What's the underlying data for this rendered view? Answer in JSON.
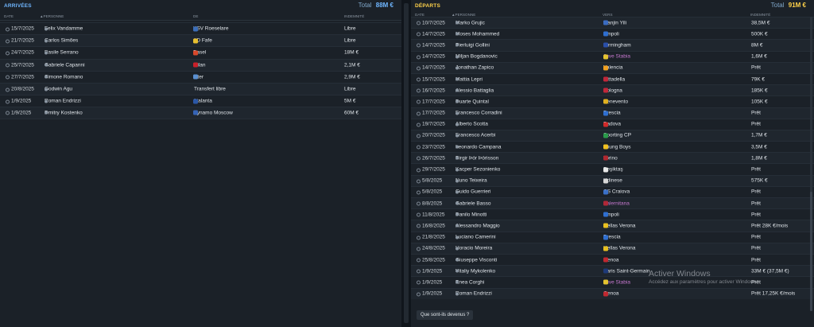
{
  "arrivals": {
    "title": "ARRIVÉES",
    "total_label": "Total",
    "total_value": "88M €",
    "columns": {
      "date": "DATE",
      "person": "PERSONNE",
      "from": "DE",
      "fee": "INDEMNITÉ"
    },
    "rows": [
      {
        "date": "15/7/2025",
        "player": "Felix Vandamme",
        "club": "KSV Roeselare",
        "fee": "Libre",
        "crest": "#3b6db8"
      },
      {
        "date": "21/7/2025",
        "player": "Carlos Simões",
        "club": "AD Fafe",
        "fee": "Libre",
        "crest": "#e8c030"
      },
      {
        "date": "24/7/2025",
        "player": "Basile Serrano",
        "club": "Basel",
        "fee": "18M €",
        "crest": "#d9482b"
      },
      {
        "date": "25/7/2025",
        "player": "Gabriele Capanni",
        "club": "Milan",
        "fee": "2,1M €",
        "crest": "#c8202a"
      },
      {
        "date": "27/7/2025",
        "player": "Simone Romano",
        "club": "Inter",
        "fee": "2,9M €",
        "crest": "#5a8fd0"
      },
      {
        "date": "20/8/2025",
        "player": "Godwin Agu",
        "club": "Transfert libre",
        "fee": "Libre",
        "crest": ""
      },
      {
        "date": "1/9/2025",
        "player": "Roman Endrizzi",
        "club": "Atalanta",
        "fee": "5M €",
        "crest": "#2b57a6"
      },
      {
        "date": "1/9/2025",
        "player": "Dmitry Kostenko",
        "club": "Dynamo Moscow",
        "fee": "60M €",
        "crest": "#3563b5"
      }
    ]
  },
  "departures": {
    "title": "DÉPARTS",
    "total_label": "Total",
    "total_value": "91M €",
    "columns": {
      "date": "DATE",
      "person": "PERSONNE",
      "to": "VERS",
      "fee": "INDEMNITÉ"
    },
    "rows": [
      {
        "date": "10/7/2025",
        "player": "Marko Grujic",
        "club": "Tianjin Yili",
        "fee": "38,5M €",
        "crest": "#3a6bc0",
        "loan": false
      },
      {
        "date": "14/7/2025",
        "player": "Moses Mohammed",
        "club": "Empoli",
        "fee": "500K €",
        "crest": "#2f6fd0",
        "loan": false
      },
      {
        "date": "14/7/2025",
        "player": "Pierluigi Gollini",
        "club": "Birmingham",
        "fee": "8M €",
        "crest": "#2a4fa8",
        "loan": false
      },
      {
        "date": "14/7/2025",
        "player": "Miljan Bogdanovic",
        "club": "Juve Stabia",
        "fee": "1,6M €",
        "crest": "#e4c330",
        "loan": true
      },
      {
        "date": "14/7/2025",
        "player": "Jonathan Zapico",
        "club": "Valencia",
        "fee": "Prêt",
        "crest": "#f0a020",
        "loan": false
      },
      {
        "date": "15/7/2025",
        "player": "Mattia Lepri",
        "club": "Cittadella",
        "fee": "79K €",
        "crest": "#c0283a",
        "loan": false
      },
      {
        "date": "16/7/2025",
        "player": "Alessio Battaglia",
        "club": "Bologna",
        "fee": "185K €",
        "crest": "#c0283a",
        "loan": false
      },
      {
        "date": "17/7/2025",
        "player": "Duarte Quintal",
        "club": "Benevento",
        "fee": "105K €",
        "crest": "#e0b020",
        "loan": false
      },
      {
        "date": "17/7/2025",
        "player": "Francesco Corradini",
        "club": "Brescia",
        "fee": "Prêt",
        "crest": "#2f6fd0",
        "loan": false
      },
      {
        "date": "19/7/2025",
        "player": "Alberto Scotta",
        "club": "Padova",
        "fee": "Prêt",
        "crest": "#d02a2a",
        "loan": false
      },
      {
        "date": "20/7/2025",
        "player": "Francesco Acerbi",
        "club": "Sporting CP",
        "fee": "1,7M €",
        "crest": "#2a9a4a",
        "loan": false
      },
      {
        "date": "23/7/2025",
        "player": "Leonardo Campana",
        "club": "Young Boys",
        "fee": "3,5M €",
        "crest": "#f0c020",
        "loan": false
      },
      {
        "date": "26/7/2025",
        "player": "Birgir Þór Þórisson",
        "club": "Torino",
        "fee": "1,8M €",
        "crest": "#b02830",
        "loan": false
      },
      {
        "date": "29/7/2025",
        "player": "Kacper Sezonienko",
        "club": "Beşiktaş",
        "fee": "Prêt",
        "crest": "#e8e8e8",
        "loan": false
      },
      {
        "date": "5/8/2025",
        "player": "Nuno Teixeira",
        "club": "Udinese",
        "fee": "575K €",
        "crest": "#d8d8d8",
        "loan": false
      },
      {
        "date": "5/8/2025",
        "player": "Guido Guerrieri",
        "club": "CS Craiova",
        "fee": "Prêt",
        "crest": "#3a70c8",
        "loan": false
      },
      {
        "date": "8/8/2025",
        "player": "Gabriele Basso",
        "club": "Salernitana",
        "fee": "Prêt",
        "crest": "#b02838",
        "loan": true
      },
      {
        "date": "11/8/2025",
        "player": "Danilo Minotti",
        "club": "Empoli",
        "fee": "Prêt",
        "crest": "#2f6fd0",
        "loan": false
      },
      {
        "date": "16/8/2025",
        "player": "Alessandro Maggio",
        "club": "Hellas Verona",
        "fee": "Prêt 28K €/mois",
        "crest": "#e8c020",
        "loan": false
      },
      {
        "date": "21/8/2025",
        "player": "Luciano Camerini",
        "club": "Brescia",
        "fee": "Prêt",
        "crest": "#2f6fd0",
        "loan": false
      },
      {
        "date": "24/8/2025",
        "player": "Horacio Moreira",
        "club": "Hellas Verona",
        "fee": "Prêt",
        "crest": "#e8c020",
        "loan": false
      },
      {
        "date": "25/8/2025",
        "player": "Giuseppe Visconti",
        "club": "Genoa",
        "fee": "Prêt",
        "crest": "#c02830",
        "loan": false
      },
      {
        "date": "1/9/2025",
        "player": "Vitaliy Mykolenko",
        "club": "Paris Saint-Germain",
        "fee": "33M € (37,5M €)",
        "crest": "#1e3a78",
        "loan": false
      },
      {
        "date": "1/9/2025",
        "player": "Enea Corghi",
        "club": "Juve Stabia",
        "fee": "Prêt",
        "crest": "#e4c330",
        "loan": true
      },
      {
        "date": "1/9/2025",
        "player": "Roman Endrizzi",
        "club": "Genoa",
        "fee": "Prêt 17,25K €/mois",
        "crest": "#c02830",
        "loan": false
      }
    ],
    "button": "Que sont-ils devenus ?"
  },
  "watermark": {
    "line1": "Activer Windows",
    "line2": "Accédez aux paramètres pour activer Windows."
  }
}
